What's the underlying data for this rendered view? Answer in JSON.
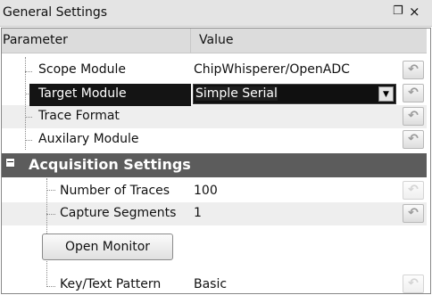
{
  "window": {
    "title": "General Settings"
  },
  "table": {
    "header_parameter": "Parameter",
    "header_value": "Value"
  },
  "rows": {
    "scope_module": {
      "label": "Scope Module",
      "value": "ChipWhisperer/OpenADC"
    },
    "target_module": {
      "label": "Target Module",
      "value": "Simple Serial"
    },
    "trace_format": {
      "label": "Trace Format",
      "value": ""
    },
    "auxiliary_module": {
      "label": "Auxilary Module",
      "value": ""
    }
  },
  "group": {
    "title": "Acquisition Settings",
    "rows": {
      "num_traces": {
        "label": "Number of Traces",
        "value": "100"
      },
      "capture_segments": {
        "label": "Capture Segments",
        "value": "1"
      },
      "open_monitor": {
        "button_label": "Open Monitor"
      },
      "key_text_pattern": {
        "label": "Key/Text Pattern",
        "value": "Basic"
      }
    }
  },
  "icons": {
    "float": "float-window-icon",
    "close": "close-icon",
    "reset": "undo-icon",
    "expander": "collapse-icon",
    "dropdown": "chevron-down-icon"
  },
  "glyphs": {
    "float": "Ɇ",
    "close": "×",
    "reset": "↶",
    "expander": "−",
    "dropdown": "▼"
  },
  "colors": {
    "selection": "#141414",
    "group_header": "#5c5c5c",
    "header_bg": "#dcdcdc"
  }
}
